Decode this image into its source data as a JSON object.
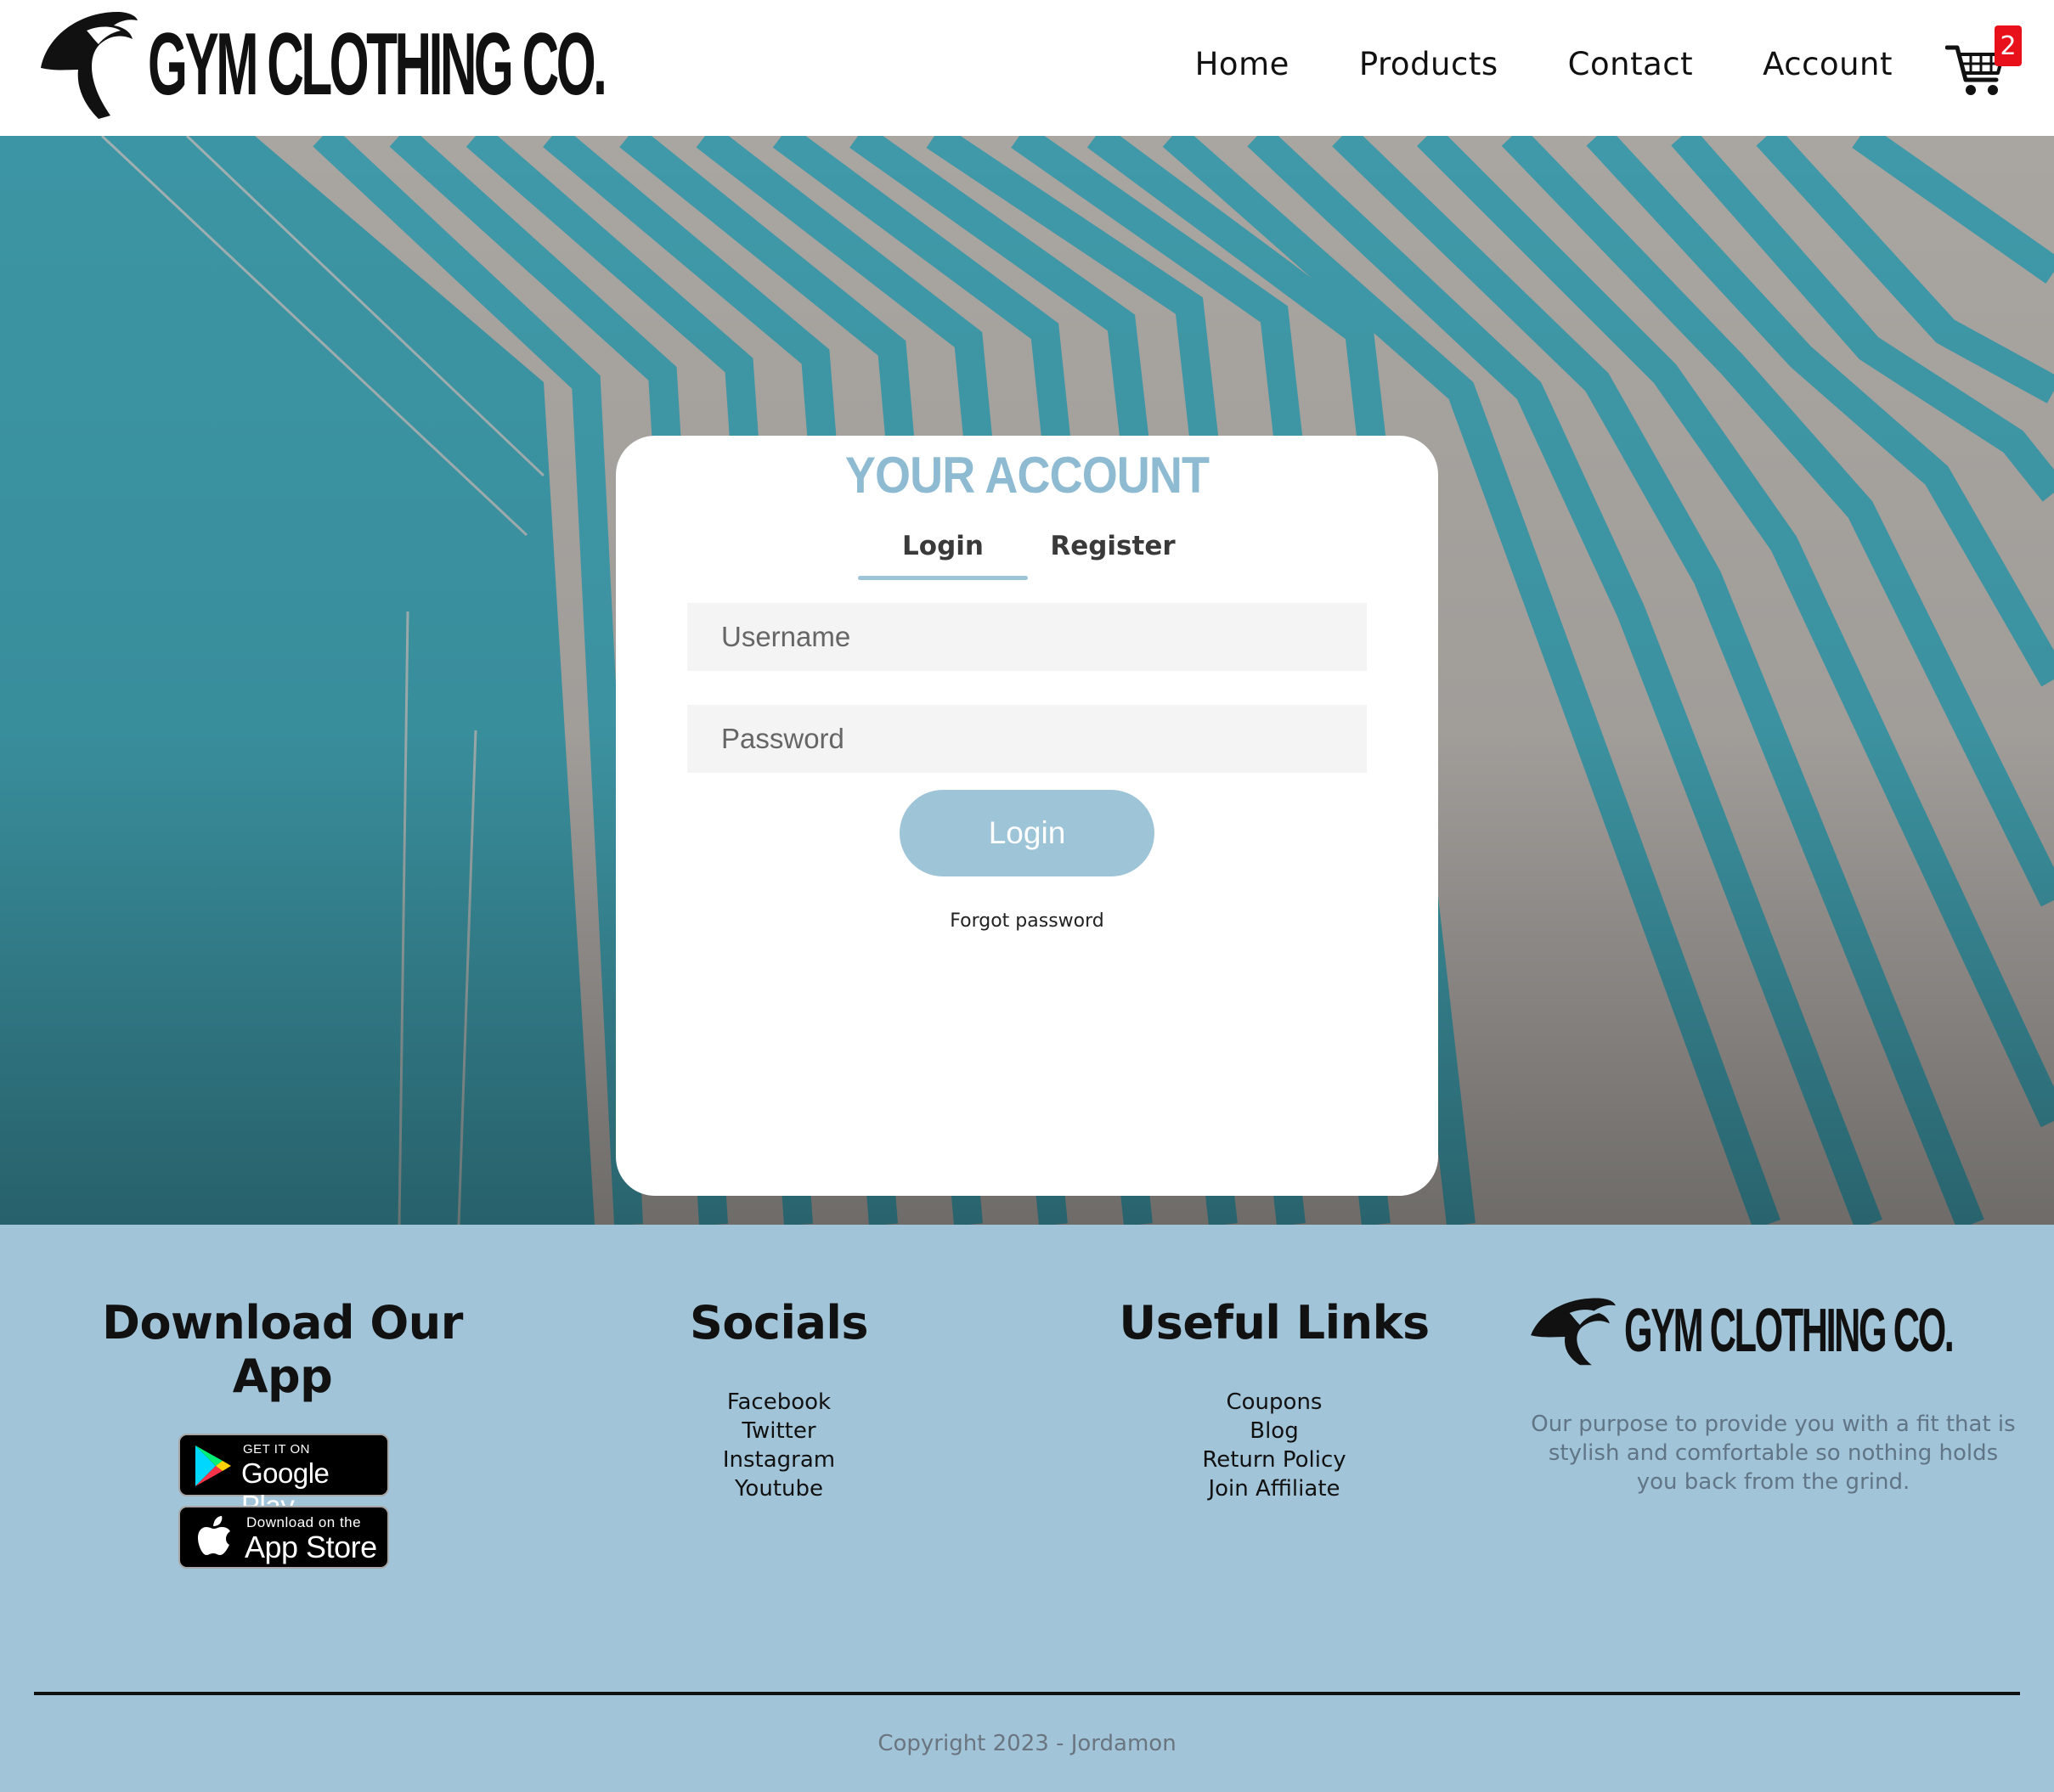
{
  "header": {
    "logo_text": "GYM CLOTHING CO.",
    "nav": [
      "Home",
      "Products",
      "Contact",
      "Account"
    ],
    "cart_count": "2"
  },
  "account": {
    "title": "YOUR ACCOUNT",
    "tabs": [
      "Login",
      "Register"
    ],
    "active_tab": "Login",
    "username_placeholder": "Username",
    "password_placeholder": "Password",
    "login_button": "Login",
    "forgot_link": "Forgot password"
  },
  "footer": {
    "app_heading": "Download Our App",
    "google_play": {
      "small": "GET IT ON",
      "big": "Google Play"
    },
    "app_store": {
      "small": "Download on the",
      "big": "App Store"
    },
    "socials_heading": "Socials",
    "socials": [
      "Facebook",
      "Twitter",
      "Instagram",
      "Youtube"
    ],
    "links_heading": "Useful Links",
    "links": [
      "Coupons",
      "Blog",
      "Return Policy",
      "Join Affiliate"
    ],
    "logo_text": "GYM CLOTHING CO.",
    "purpose": "Our purpose to provide you with a fit that is stylish and comfortable so nothing holds you back from the grind.",
    "copyright": "Copyright 2023 - Jordamon"
  },
  "colors": {
    "accent": "#9ec4d8",
    "footer_bg": "#a1c4d9",
    "teal_wall": "#3f99a8",
    "badge": "#e8101a"
  },
  "icons": [
    "eagle-logo-icon",
    "shopping-cart-icon",
    "google-play-icon",
    "apple-icon"
  ]
}
